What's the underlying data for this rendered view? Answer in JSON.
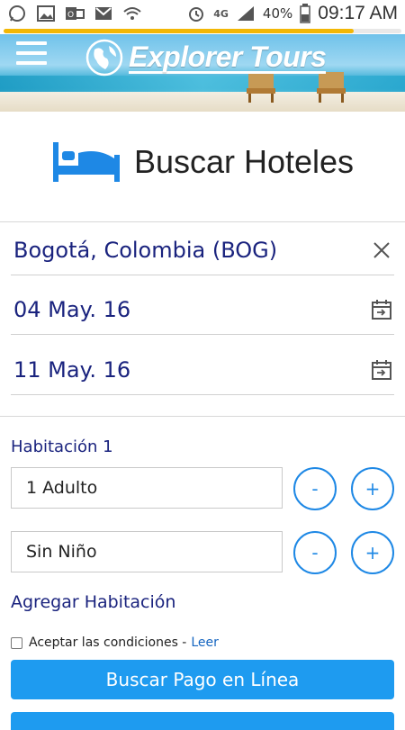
{
  "status_bar": {
    "battery": "40%",
    "network": "4G",
    "time": "09:17 AM"
  },
  "loading": {
    "progress": 0.88,
    "color": "#f2b705"
  },
  "header": {
    "menu_icon": "hamburger-menu-icon",
    "logo_text": "Explorer Tours"
  },
  "page": {
    "title": "Buscar Hoteles",
    "title_icon": "bed-icon"
  },
  "search": {
    "destination": "Bogotá, Colombia (BOG)",
    "checkin": "04 May. 16",
    "checkout": "11 May. 16"
  },
  "room": {
    "label": "Habitación 1",
    "adults": "1 Adulto",
    "children": "Sin Niño",
    "minus": "-",
    "plus": "+"
  },
  "add_room": "Agregar Habitación",
  "terms": {
    "label": "Aceptar las condiciones -",
    "link": "Leer"
  },
  "actions": {
    "search_button": "Buscar Pago en Línea"
  },
  "colors": {
    "accent": "#1e9bf0",
    "text_blue": "#1a237e",
    "icon_blue": "#1e88e5"
  }
}
